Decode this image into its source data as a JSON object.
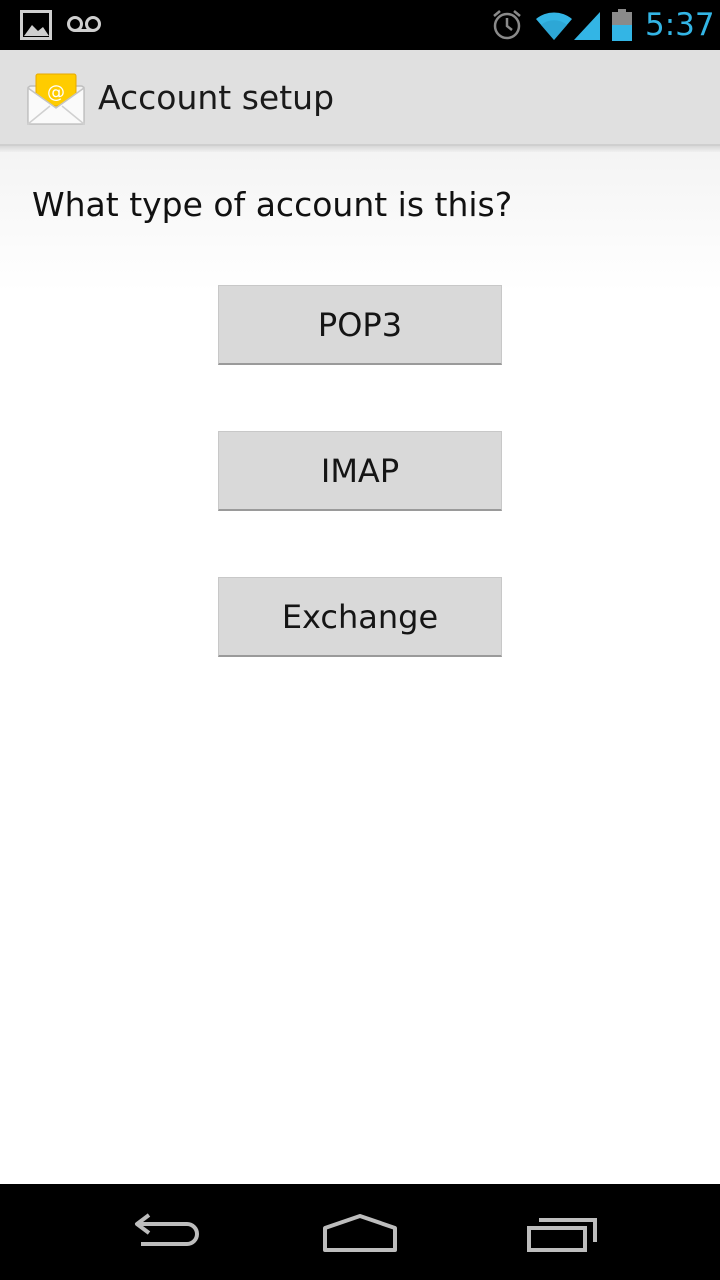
{
  "status_bar": {
    "time": "5:37",
    "icons": [
      "gallery-icon",
      "voicemail-icon",
      "alarm-icon",
      "wifi-icon",
      "signal-icon",
      "battery-icon"
    ],
    "accent_color": "#33b5e5"
  },
  "action_bar": {
    "icon": "email-envelope-icon",
    "title": "Account setup"
  },
  "content": {
    "question": "What type of account is this?",
    "options": [
      {
        "label": "POP3"
      },
      {
        "label": "IMAP"
      },
      {
        "label": "Exchange"
      }
    ]
  },
  "nav_bar": {
    "icons": [
      "back-icon",
      "home-icon",
      "recents-icon"
    ]
  }
}
